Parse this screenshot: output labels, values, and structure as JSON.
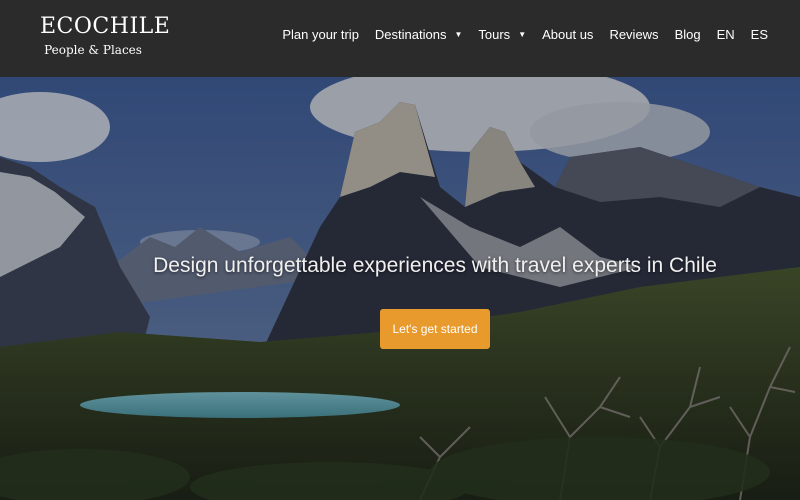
{
  "brand": {
    "name": "ECOCHILE",
    "tagline": "People & Places"
  },
  "nav": {
    "items": [
      {
        "label": "Plan your trip"
      },
      {
        "label": "Destinations",
        "icon": "caret-down-icon"
      },
      {
        "label": "Tours",
        "icon": "caret-down-icon"
      },
      {
        "label": "About us"
      },
      {
        "label": "Reviews"
      },
      {
        "label": "Blog"
      },
      {
        "label": "EN"
      },
      {
        "label": "ES"
      }
    ]
  },
  "hero": {
    "headline": "Design unforgettable experiences with travel experts in Chile",
    "cta_label": "Let's get started"
  },
  "colors": {
    "header_bg": "#2b2b2b",
    "cta_bg": "#e89a2c"
  }
}
